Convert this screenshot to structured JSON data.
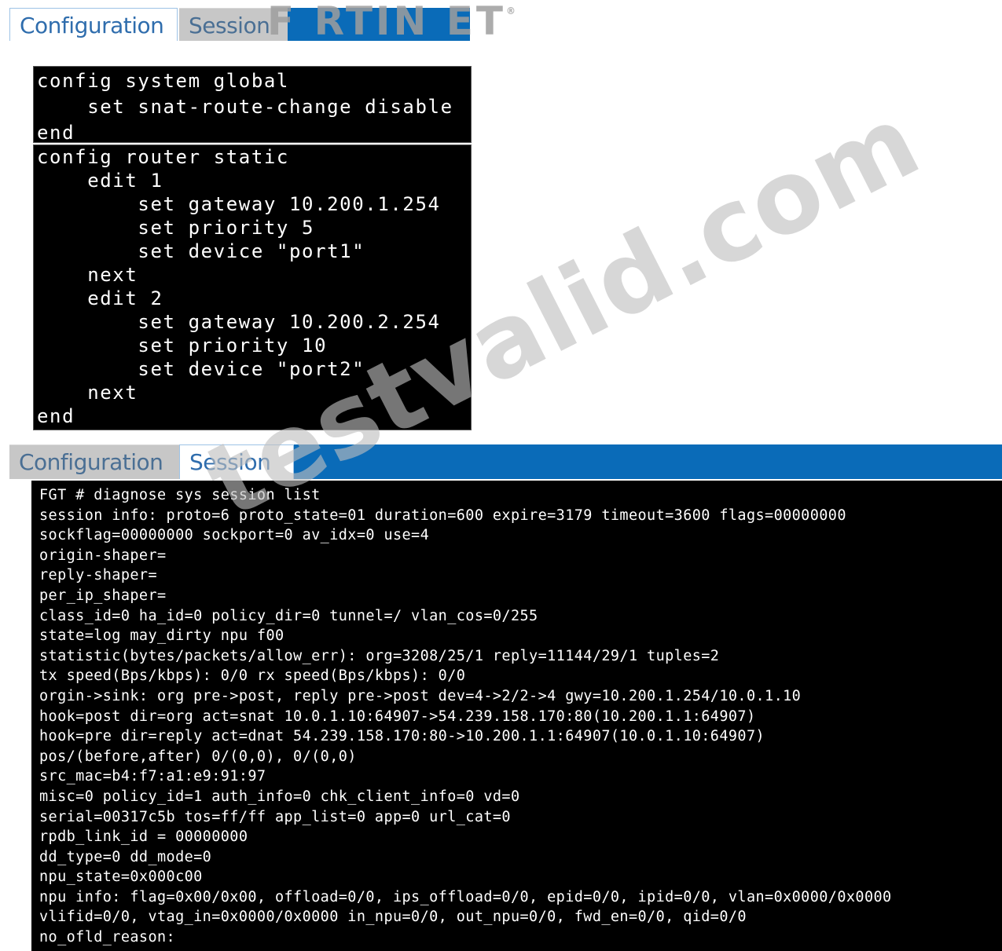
{
  "top_tabs": {
    "configuration": "Configuration",
    "session": "Session"
  },
  "logo": {
    "text": "F RTIN ET",
    "mark": "®"
  },
  "config_global": [
    "config system global",
    "    set snat-route-change disable",
    "end"
  ],
  "config_router": [
    "config router static",
    "    edit 1",
    "        set gateway 10.200.1.254",
    "        set priority 5",
    "        set device \"port1\"",
    "    next",
    "    edit 2",
    "        set gateway 10.200.2.254",
    "        set priority 10",
    "        set device \"port2\"",
    "    next",
    "end"
  ],
  "session_tabs": {
    "configuration": "Configuration",
    "session": "Session"
  },
  "session_output": [
    "FGT # diagnose sys session list",
    "session info: proto=6 proto_state=01 duration=600 expire=3179 timeout=3600 flags=00000000",
    "sockflag=00000000 sockport=0 av_idx=0 use=4",
    "origin-shaper=",
    "reply-shaper=",
    "per_ip_shaper=",
    "class_id=0 ha_id=0 policy_dir=0 tunnel=/ vlan_cos=0/255",
    "state=log may_dirty npu f00",
    "statistic(bytes/packets/allow_err): org=3208/25/1 reply=11144/29/1 tuples=2",
    "tx speed(Bps/kbps): 0/0 rx speed(Bps/kbps): 0/0",
    "orgin->sink: org pre->post, reply pre->post dev=4->2/2->4 gwy=10.200.1.254/10.0.1.10",
    "hook=post dir=org act=snat 10.0.1.10:64907->54.239.158.170:80(10.200.1.1:64907)",
    "hook=pre dir=reply act=dnat 54.239.158.170:80->10.200.1.1:64907(10.0.1.10:64907)",
    "pos/(before,after) 0/(0,0), 0/(0,0)",
    "src_mac=b4:f7:a1:e9:91:97",
    "misc=0 policy_id=1 auth_info=0 chk_client_info=0 vd=0",
    "serial=00317c5b tos=ff/ff app_list=0 app=0 url_cat=0",
    "rpdb_link_id = 00000000",
    "dd_type=0 dd_mode=0",
    "npu_state=0x000c00",
    "npu info: flag=0x00/0x00, offload=0/0, ips_offload=0/0, epid=0/0, ipid=0/0, vlan=0x0000/0x0000",
    "vlifid=0/0, vtag_in=0x0000/0x0000 in_npu=0/0, out_npu=0/0, fwd_en=0/0, qid=0/0",
    "no_ofld_reason:"
  ],
  "watermark": "testvalid.com"
}
